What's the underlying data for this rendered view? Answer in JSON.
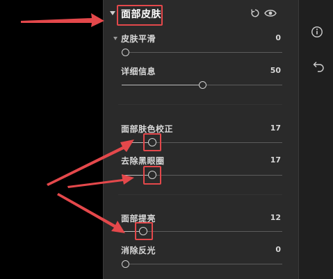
{
  "section": {
    "title": "面部皮肤"
  },
  "sliders": [
    {
      "label": "皮肤平滑",
      "value": "0"
    },
    {
      "label": "详细信息",
      "value": "50"
    },
    {
      "label": "面部肤色校正",
      "value": "17"
    },
    {
      "label": "去除黑眼圈",
      "value": "17"
    },
    {
      "label": "面部提亮",
      "value": "12"
    },
    {
      "label": "消除反光",
      "value": "0"
    }
  ],
  "icons": {
    "reset": "reset-icon",
    "visibility": "eye-icon",
    "info": "info-icon",
    "undo": "undo-icon"
  },
  "colors": {
    "highlight": "#e4484b",
    "panel": "#2a2a2a"
  }
}
